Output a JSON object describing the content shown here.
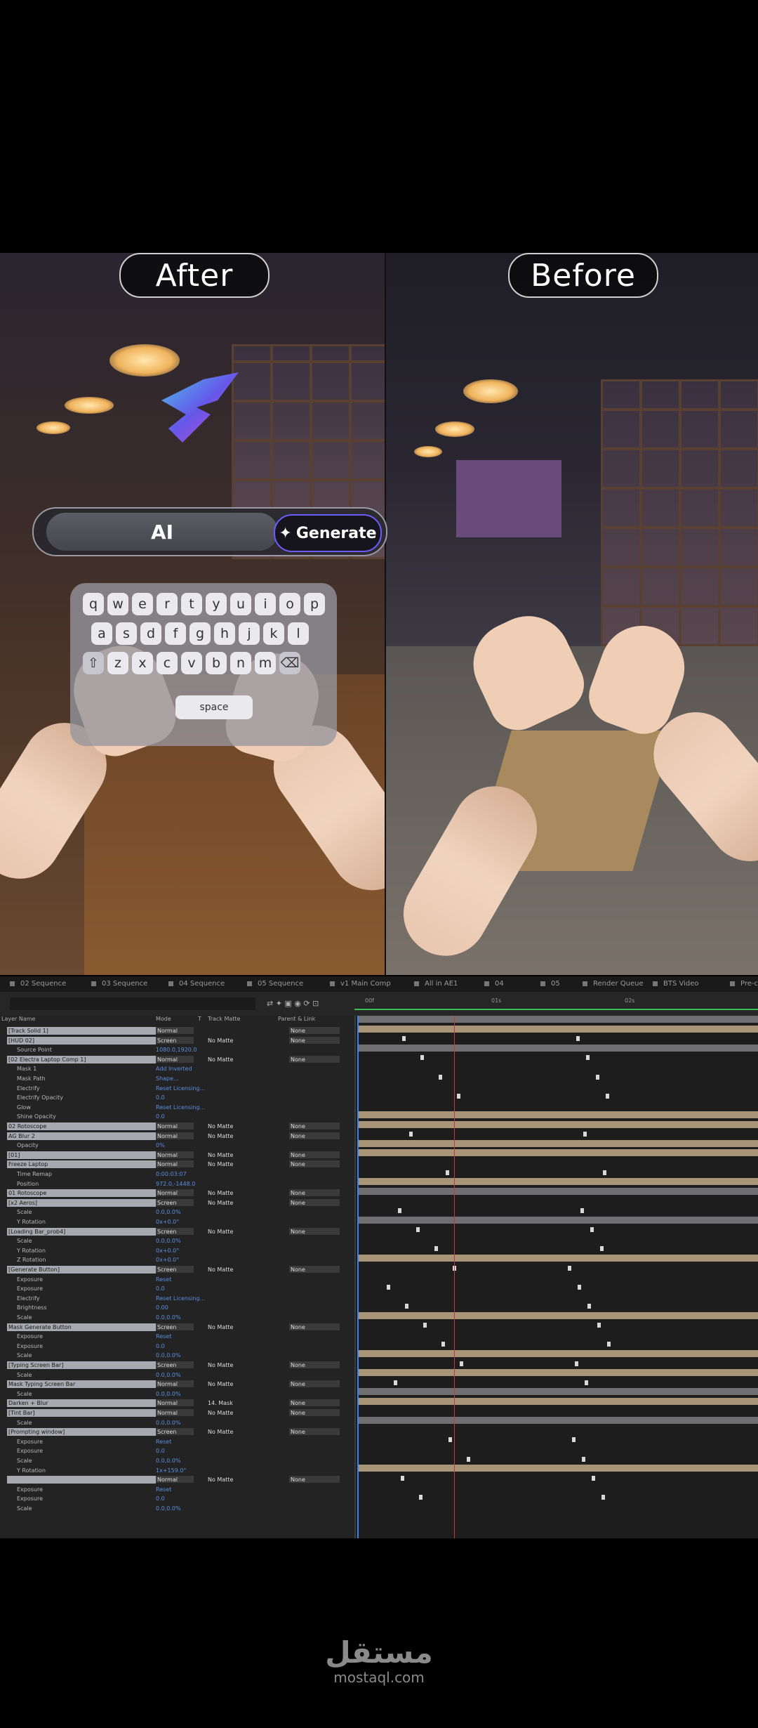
{
  "video": {
    "left_label": "After",
    "right_label": "Before",
    "prompt_text": "AI",
    "generate_label": "Generate",
    "keyboard_rows": [
      [
        "q",
        "w",
        "e",
        "r",
        "t",
        "y",
        "u",
        "i",
        "o",
        "p"
      ],
      [
        "a",
        "s",
        "d",
        "f",
        "g",
        "h",
        "j",
        "k",
        "l"
      ],
      [
        "⇧",
        "z",
        "x",
        "c",
        "v",
        "b",
        "n",
        "m",
        "⌫"
      ]
    ],
    "space_label": "space"
  },
  "ae": {
    "tabs": [
      "02 Sequence",
      "03 Sequence",
      "04 Sequence",
      "05 Sequence",
      "v1 Main Comp",
      "All in AE1",
      "04",
      "05",
      "Render Queue",
      "BTS Video",
      "Pre-c"
    ],
    "header": {
      "layer_name": "Layer Name",
      "mode": "Mode",
      "t": "T",
      "track_matte": "Track Matte",
      "parent": "Parent & Link"
    },
    "time_marks": [
      "00f",
      "01s",
      "02s"
    ],
    "rows": [
      {
        "kind": "layer",
        "name": "[Track Solid 1]",
        "mode": "Normal",
        "matte": "",
        "parent": "None"
      },
      {
        "kind": "layer",
        "name": "[HUD 02]",
        "mode": "Screen",
        "matte": "No Matte",
        "parent": "None"
      },
      {
        "kind": "prop",
        "name": "Source Point",
        "value": "1080.0,1920.0"
      },
      {
        "kind": "layer",
        "name": "[02 Electra Laptop Comp 1]",
        "mode": "Normal",
        "matte": "No Matte",
        "parent": "None"
      },
      {
        "kind": "prop",
        "name": "Mask 1",
        "value": "Add   Inverted"
      },
      {
        "kind": "prop",
        "name": "Mask Path",
        "value": "Shape..."
      },
      {
        "kind": "prop",
        "name": "Electrify",
        "value": "Reset   Licensing..."
      },
      {
        "kind": "prop",
        "name": "Electrify Opacity",
        "value": "0.0"
      },
      {
        "kind": "prop",
        "name": "Glow",
        "value": "Reset   Licensing..."
      },
      {
        "kind": "prop",
        "name": "Shine Opacity",
        "value": "0.0"
      },
      {
        "kind": "layer",
        "name": "02 Rotoscope",
        "mode": "Normal",
        "matte": "No Matte",
        "parent": "None"
      },
      {
        "kind": "layer",
        "name": "AG Blur 2",
        "mode": "Normal",
        "matte": "No Matte",
        "parent": "None"
      },
      {
        "kind": "prop",
        "name": "Opacity",
        "value": "0%"
      },
      {
        "kind": "layer",
        "name": "[01]",
        "mode": "Normal",
        "matte": "No Matte",
        "parent": "None"
      },
      {
        "kind": "layer",
        "name": "Freeze Laptop",
        "mode": "Normal",
        "matte": "No Matte",
        "parent": "None"
      },
      {
        "kind": "prop",
        "name": "Time Remap",
        "value": "0:00:03:07"
      },
      {
        "kind": "prop",
        "name": "Position",
        "value": "972.0,-1448.0"
      },
      {
        "kind": "layer",
        "name": "01 Rotoscope",
        "mode": "Normal",
        "matte": "No Matte",
        "parent": "None"
      },
      {
        "kind": "layer",
        "name": "[x2 Aeros]",
        "mode": "Screen",
        "matte": "No Matte",
        "parent": "None"
      },
      {
        "kind": "prop",
        "name": "Scale",
        "value": "0.0,0.0%"
      },
      {
        "kind": "prop",
        "name": "Y Rotation",
        "value": "0x+0.0°"
      },
      {
        "kind": "layer",
        "name": "[Loading Bar_prob4]",
        "mode": "Screen",
        "matte": "No Matte",
        "parent": "None"
      },
      {
        "kind": "prop",
        "name": "Scale",
        "value": "0.0,0.0%"
      },
      {
        "kind": "prop",
        "name": "Y Rotation",
        "value": "0x+0.0°"
      },
      {
        "kind": "prop",
        "name": "Z Rotation",
        "value": "0x+0.0°"
      },
      {
        "kind": "layer",
        "name": "[Generate Button]",
        "mode": "Screen",
        "matte": "No Matte",
        "parent": "None"
      },
      {
        "kind": "prop",
        "name": "Exposure",
        "value": "Reset"
      },
      {
        "kind": "prop",
        "name": "Exposure",
        "value": "0.0"
      },
      {
        "kind": "prop",
        "name": "Electrify",
        "value": "Reset   Licensing..."
      },
      {
        "kind": "prop",
        "name": "Brightness",
        "value": "0.00"
      },
      {
        "kind": "prop",
        "name": "Scale",
        "value": "0.0,0.0%"
      },
      {
        "kind": "layer",
        "name": "Mask Generate Button",
        "mode": "Screen",
        "matte": "No Matte",
        "parent": "None"
      },
      {
        "kind": "prop",
        "name": "Exposure",
        "value": "Reset"
      },
      {
        "kind": "prop",
        "name": "Exposure",
        "value": "0.0"
      },
      {
        "kind": "prop",
        "name": "Scale",
        "value": "0.0,0.0%"
      },
      {
        "kind": "layer",
        "name": "[Typing Screen Bar]",
        "mode": "Screen",
        "matte": "No Matte",
        "parent": "None"
      },
      {
        "kind": "prop",
        "name": "Scale",
        "value": "0.0,0.0%"
      },
      {
        "kind": "layer",
        "name": "Mask Typing Screen Bar",
        "mode": "Normal",
        "matte": "No Matte",
        "parent": "None"
      },
      {
        "kind": "prop",
        "name": "Scale",
        "value": "0.0,0.0%"
      },
      {
        "kind": "layer",
        "name": "Darken + Blur",
        "mode": "Normal",
        "matte": "14. Mask",
        "parent": "None"
      },
      {
        "kind": "layer",
        "name": "[Tint Bar]",
        "mode": "Normal",
        "matte": "No Matte",
        "parent": "None"
      },
      {
        "kind": "prop",
        "name": "Scale",
        "value": "0.0,0.0%"
      },
      {
        "kind": "layer",
        "name": "[Prompting window]",
        "mode": "Screen",
        "matte": "No Matte",
        "parent": "None"
      },
      {
        "kind": "prop",
        "name": "Exposure",
        "value": "Reset"
      },
      {
        "kind": "prop",
        "name": "Exposure",
        "value": "0.0"
      },
      {
        "kind": "prop",
        "name": "Scale",
        "value": "0.0,0.0%"
      },
      {
        "kind": "prop",
        "name": "Y Rotation",
        "value": "1x+159.0°"
      },
      {
        "kind": "layer",
        "name": "",
        "mode": "Normal",
        "matte": "No Matte",
        "parent": "None"
      },
      {
        "kind": "prop",
        "name": "Exposure",
        "value": "Reset"
      },
      {
        "kind": "prop",
        "name": "Exposure",
        "value": "0.0"
      },
      {
        "kind": "prop",
        "name": "Scale",
        "value": "0.0,0.0%"
      }
    ]
  },
  "watermark": {
    "arabic": "مستقل",
    "latin": "mostaql.com"
  },
  "colors": {
    "accent": "#3e82e6",
    "bar": "#a89577",
    "generate_border": "#6d5cff"
  }
}
